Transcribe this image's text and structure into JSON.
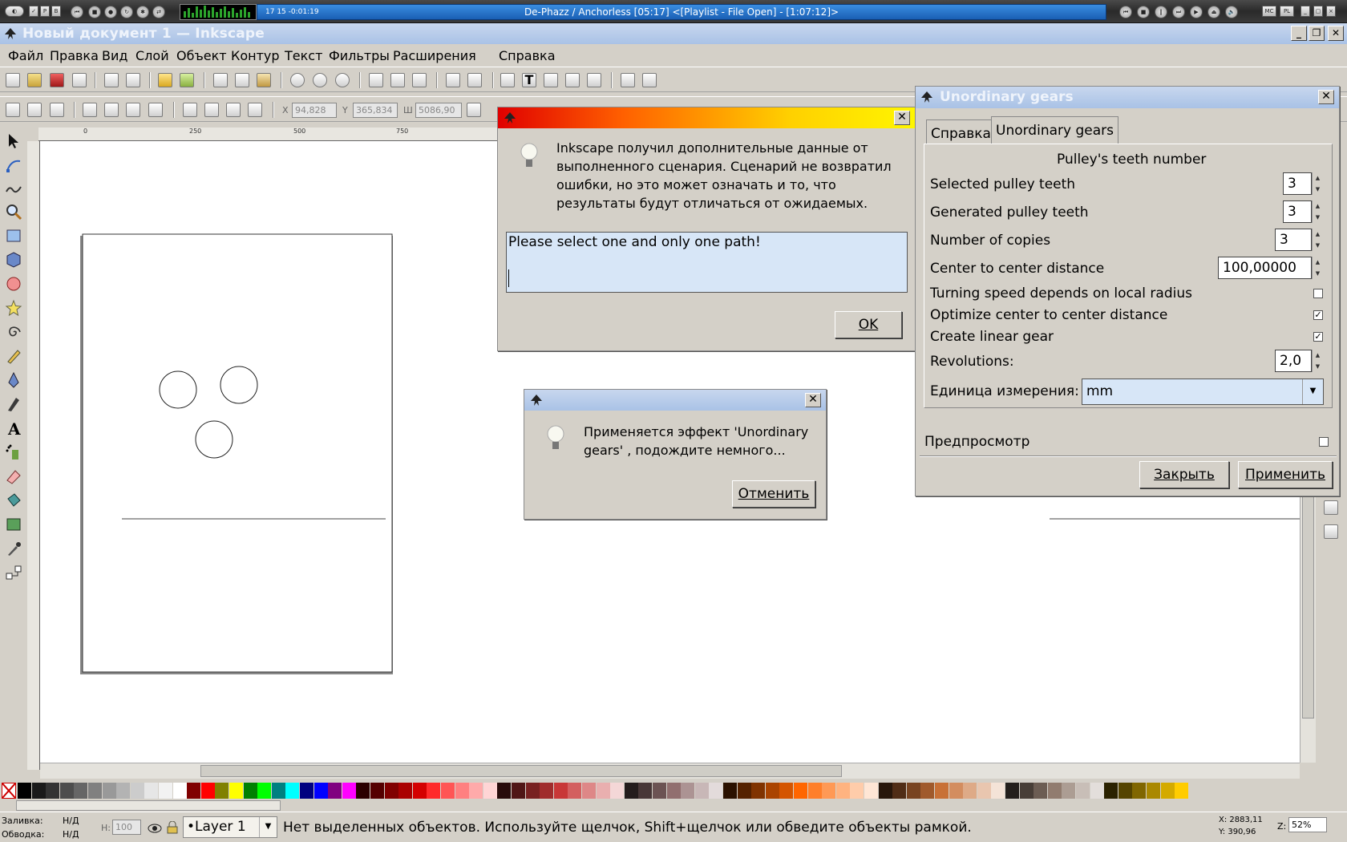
{
  "winamp": {
    "track_counts": "17    15    -0:01:19",
    "track_title": "De-Phazz / Anchorless  [05:17]    <[Playlist - File Open] - [1:07:12]>"
  },
  "window": {
    "title": "Новый документ 1 — Inkscape"
  },
  "menu": [
    "Файл",
    "Правка",
    "Вид",
    "Слой",
    "Объект",
    "Контур",
    "Текст",
    "Фильтры",
    "Расширения",
    "Справка"
  ],
  "tool_controls": {
    "x_label": "X",
    "x_value": "94,828",
    "y_label": "Y",
    "y_value": "365,834",
    "w_label": "Ш",
    "w_value": "5086,90"
  },
  "ruler_h": [
    "0",
    "250",
    "500",
    "750"
  ],
  "dialog_result": {
    "message": "Inkscape получил дополнительные данные от выполненного сценария. Сценарий не возвратил ошибки, но это может означать и то, что результаты будут отличаться от ожидаемых.",
    "output": "Please select one and only one path!",
    "ok_label": "OK"
  },
  "dialog_progress": {
    "message": "Применяется эффект 'Unordinary gears' , подождите немного...",
    "cancel_label": "Отменить"
  },
  "gears_panel": {
    "title": "Unordinary gears",
    "tabs": [
      "Справка",
      "Unordinary gears"
    ],
    "section_title": "Pulley's teeth number",
    "fields": [
      {
        "label": "Selected pulley teeth",
        "value": "3"
      },
      {
        "label": "Generated pulley teeth",
        "value": "3"
      },
      {
        "label": "Number of copies",
        "value": "3"
      },
      {
        "label": "Center to center distance",
        "value": "100,00000"
      }
    ],
    "checks": [
      {
        "label": "Turning speed depends on local radius",
        "checked": false
      },
      {
        "label": "Optimize center to center distance",
        "checked": true
      },
      {
        "label": "Create linear gear",
        "checked": true
      }
    ],
    "revolutions_label": "Revolutions:",
    "revolutions_value": "2,0",
    "unit_label": "Единица измерения:",
    "unit_value": "mm",
    "preview_label": "Предпросмотр",
    "close_label": "Закрыть",
    "apply_label": "Применить"
  },
  "status": {
    "fill_label": "Заливка:",
    "fill_value": "Н/Д",
    "stroke_label": "Обводка:",
    "stroke_value": "Н/Д",
    "opacity_label": "Н:",
    "opacity_value": "100",
    "layer": "•Layer 1",
    "message": "Нет выделенных объектов. Используйте щелчок, Shift+щелчок или обведите объекты рамкой.",
    "x_readout": "X: 2883,11",
    "y_readout": "Y:  390,96",
    "zoom_label": "Z:",
    "zoom_value": "52%"
  },
  "colors": {
    "accent": "#a9c2e6",
    "dialog_bg": "#d4d0c8"
  }
}
